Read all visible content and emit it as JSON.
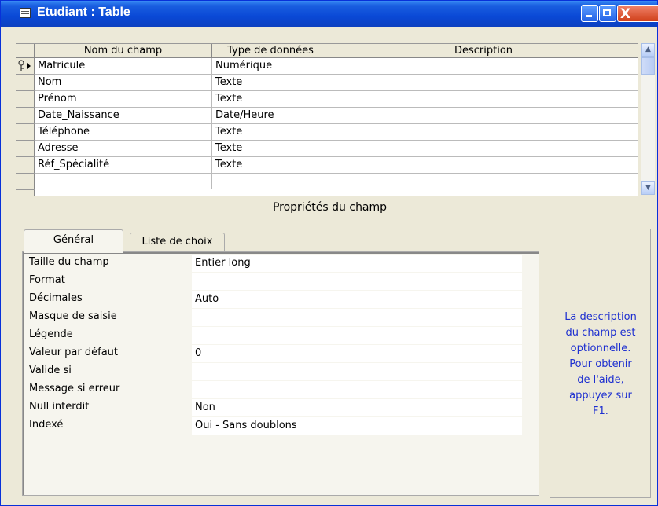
{
  "window": {
    "title": "Etudiant : Table",
    "close_glyph": "X"
  },
  "grid": {
    "headers": [
      "Nom du champ",
      "Type de données",
      "Description"
    ],
    "rows": [
      {
        "name": "Matricule",
        "type": "Numérique",
        "description": "",
        "primary_key": true
      },
      {
        "name": "Nom",
        "type": "Texte",
        "description": ""
      },
      {
        "name": "Prénom",
        "type": "Texte",
        "description": ""
      },
      {
        "name": "Date_Naissance",
        "type": "Date/Heure",
        "description": ""
      },
      {
        "name": "Téléphone",
        "type": "Texte",
        "description": ""
      },
      {
        "name": "Adresse",
        "type": "Texte",
        "description": ""
      },
      {
        "name": "Réf_Spécialité",
        "type": "Texte",
        "description": ""
      },
      {
        "name": "",
        "type": "",
        "description": ""
      }
    ]
  },
  "properties": {
    "section_title": "Propriétés du champ",
    "tabs": [
      "Général",
      "Liste de choix"
    ],
    "active_tab": "Général",
    "fields": [
      {
        "label": "Taille du champ",
        "value": "Entier long"
      },
      {
        "label": "Format",
        "value": ""
      },
      {
        "label": "Décimales",
        "value": "Auto"
      },
      {
        "label": "Masque de saisie",
        "value": ""
      },
      {
        "label": "Légende",
        "value": ""
      },
      {
        "label": "Valeur par défaut",
        "value": "0"
      },
      {
        "label": "Valide si",
        "value": ""
      },
      {
        "label": "Message si erreur",
        "value": ""
      },
      {
        "label": "Null interdit",
        "value": "Non"
      },
      {
        "label": "Indexé",
        "value": "Oui - Sans doublons"
      }
    ]
  },
  "help": {
    "lines": [
      "La description",
      "du champ est",
      "optionnelle.",
      "Pour obtenir",
      "de l'aide,",
      "appuyez sur",
      "F1."
    ]
  },
  "colors": {
    "titlebar": "#0a49d6",
    "help_text": "#1d2fd0",
    "panel": "#ece9d8"
  }
}
